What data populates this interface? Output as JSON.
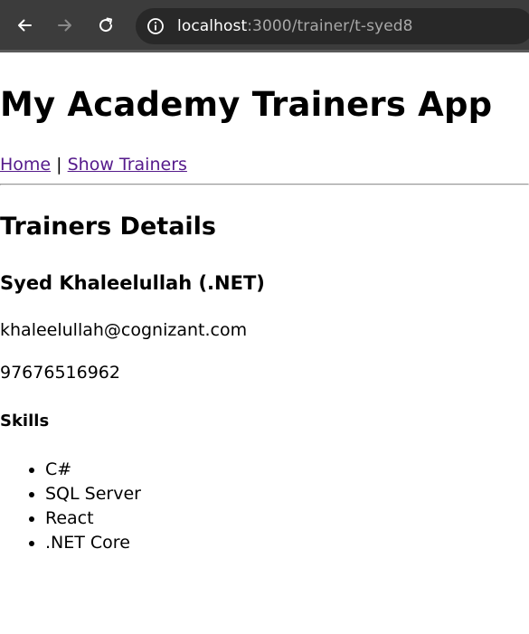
{
  "browser": {
    "url_host": "localhost",
    "url_path": ":3000/trainer/t-syed8",
    "icons": [
      "back-arrow-icon",
      "forward-arrow-icon",
      "reload-icon",
      "info-icon"
    ]
  },
  "app": {
    "title": "My Academy Trainers App",
    "nav": {
      "home": "Home",
      "separator": "|",
      "show_trainers": "Show Trainers"
    }
  },
  "details": {
    "heading": "Trainers Details",
    "name": "Syed Khaleelullah (.NET)",
    "email": "khaleelullah@cognizant.com",
    "phone": "97676516962",
    "skills_heading": "Skills",
    "skills": [
      "C#",
      "SQL Server",
      "React",
      ".NET Core"
    ]
  },
  "colors": {
    "chrome_bg": "#3c3c3c",
    "url_bar_bg": "#282828",
    "visited_link": "#551a8b"
  }
}
